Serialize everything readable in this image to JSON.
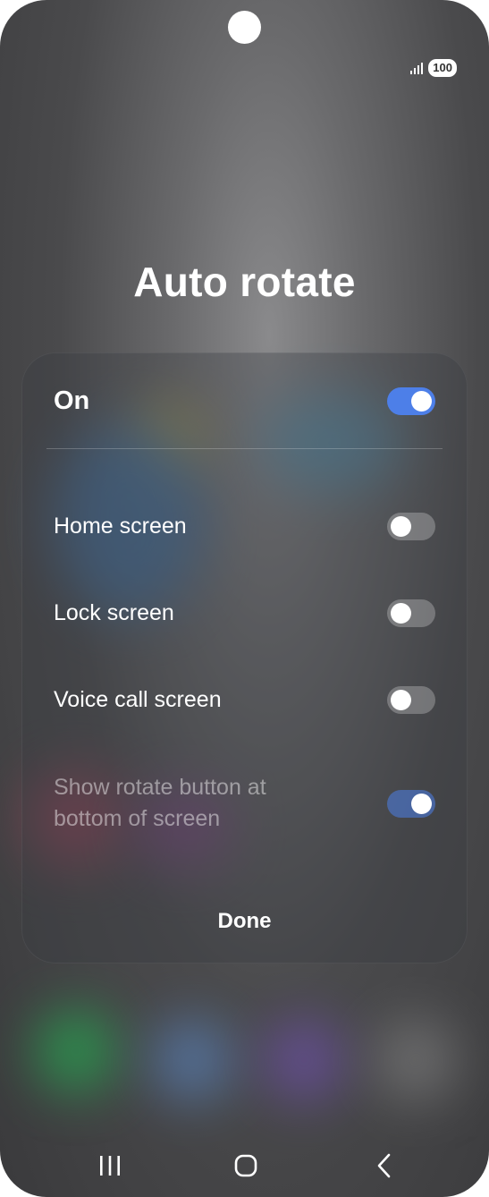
{
  "status_bar": {
    "battery": "100",
    "signal_icon": "signal-bars-icon"
  },
  "title": "Auto rotate",
  "settings": {
    "main": {
      "label": "On",
      "state": "on"
    },
    "items": [
      {
        "label": "Home screen",
        "state": "off"
      },
      {
        "label": "Lock screen",
        "state": "off"
      },
      {
        "label": "Voice call screen",
        "state": "off"
      },
      {
        "label": "Show rotate button at bottom of screen",
        "state": "on",
        "disabled": true
      }
    ]
  },
  "done_label": "Done",
  "nav": {
    "recents_icon": "recents-icon",
    "home_icon": "home-icon",
    "back_icon": "back-icon"
  },
  "colors": {
    "accent": "#4d7fe8",
    "text": "#ffffff"
  }
}
